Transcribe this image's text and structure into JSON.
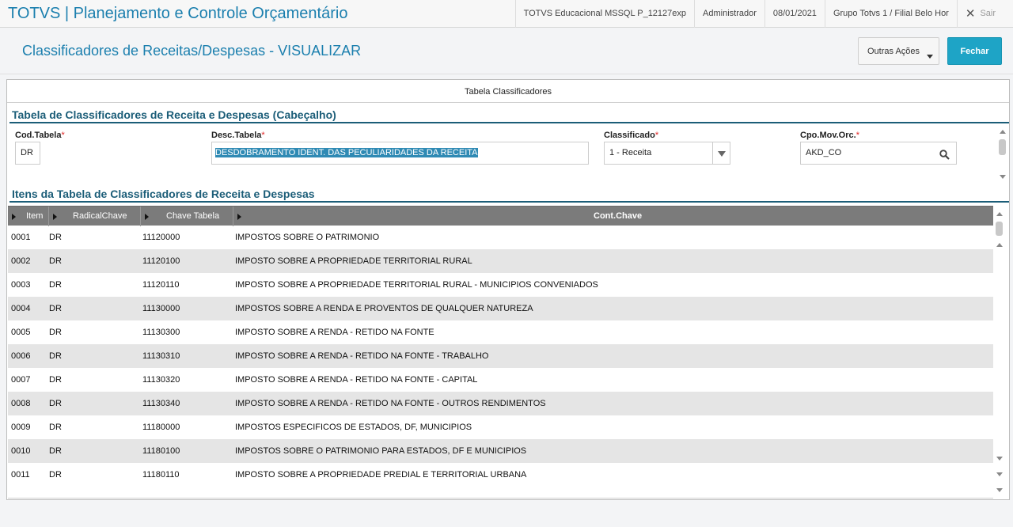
{
  "topbar": {
    "app_title": "TOTVS | Planejamento e Controle Orçamentário",
    "environment": "TOTVS Educacional MSSQL P_12127exp",
    "user": "Administrador",
    "date": "08/01/2021",
    "company": "Grupo Totvs 1 / Filial Belo Hor",
    "exit_label": "Sair"
  },
  "header": {
    "page_title": "Classificadores de Receitas/Despesas - VISUALIZAR",
    "other_actions_label": "Outras Ações",
    "close_label": "Fechar"
  },
  "folder_tab": "Tabela Classificadores",
  "header_section": {
    "title": "Tabela de Classificadores de Receita e Despesas (Cabeçalho)",
    "fields": {
      "cod_tabela": {
        "label": "Cod.Tabela",
        "value": "DR"
      },
      "desc_tabela": {
        "label": "Desc.Tabela",
        "value": "DESDOBRAMENTO IDENT. DAS PECULIARIDADES DA RECEITA"
      },
      "classificado": {
        "label": "Classificado",
        "value": "1 - Receita"
      },
      "cpo_mov_orc": {
        "label": "Cpo.Mov.Orc.",
        "value": "AKD_CO"
      }
    },
    "required_mark": "*"
  },
  "items_section": {
    "title": "Itens da Tabela de Classificadores de Receita e Despesas",
    "columns": [
      "Item",
      "RadicalChave",
      "Chave Tabela",
      "Cont.Chave"
    ],
    "rows": [
      {
        "item": "0001",
        "radical": "DR",
        "chave": "11120000",
        "cont": "IMPOSTOS SOBRE O PATRIMONIO"
      },
      {
        "item": "0002",
        "radical": "DR",
        "chave": "11120100",
        "cont": "IMPOSTO SOBRE A PROPRIEDADE TERRITORIAL RURAL"
      },
      {
        "item": "0003",
        "radical": "DR",
        "chave": "11120110",
        "cont": "IMPOSTO SOBRE A PROPRIEDADE TERRITORIAL RURAL - MUNICIPIOS CONVENIADOS"
      },
      {
        "item": "0004",
        "radical": "DR",
        "chave": "11130000",
        "cont": "IMPOSTOS SOBRE A RENDA E PROVENTOS DE QUALQUER NATUREZA"
      },
      {
        "item": "0005",
        "radical": "DR",
        "chave": "11130300",
        "cont": "IMPOSTO SOBRE A RENDA - RETIDO NA FONTE"
      },
      {
        "item": "0006",
        "radical": "DR",
        "chave": "11130310",
        "cont": "IMPOSTO SOBRE A RENDA - RETIDO NA FONTE - TRABALHO"
      },
      {
        "item": "0007",
        "radical": "DR",
        "chave": "11130320",
        "cont": "IMPOSTO SOBRE A RENDA - RETIDO NA FONTE - CAPITAL"
      },
      {
        "item": "0008",
        "radical": "DR",
        "chave": "11130340",
        "cont": "IMPOSTO SOBRE A RENDA - RETIDO NA FONTE - OUTROS RENDIMENTOS"
      },
      {
        "item": "0009",
        "radical": "DR",
        "chave": "11180000",
        "cont": "IMPOSTOS ESPECIFICOS DE ESTADOS, DF, MUNICIPIOS"
      },
      {
        "item": "0010",
        "radical": "DR",
        "chave": "11180100",
        "cont": "IMPOSTOS SOBRE O PATRIMONIO PARA ESTADOS, DF E MUNICIPIOS"
      },
      {
        "item": "0011",
        "radical": "DR",
        "chave": "11180110",
        "cont": "IMPOSTO SOBRE A PROPRIEDADE PREDIAL E TERRITORIAL URBANA"
      }
    ]
  },
  "colors": {
    "accent": "#1b7fae",
    "section_title": "#1b5d78",
    "primary_button": "#1ea4c6",
    "grid_header": "#7b7b7b",
    "row_alt": "#e5e5e5",
    "required": "#e02020"
  },
  "icons": {
    "exit": "close-icon",
    "lookup": "search-icon",
    "select": "chevron-down-icon",
    "column_sort": "triangle-right-icon"
  }
}
